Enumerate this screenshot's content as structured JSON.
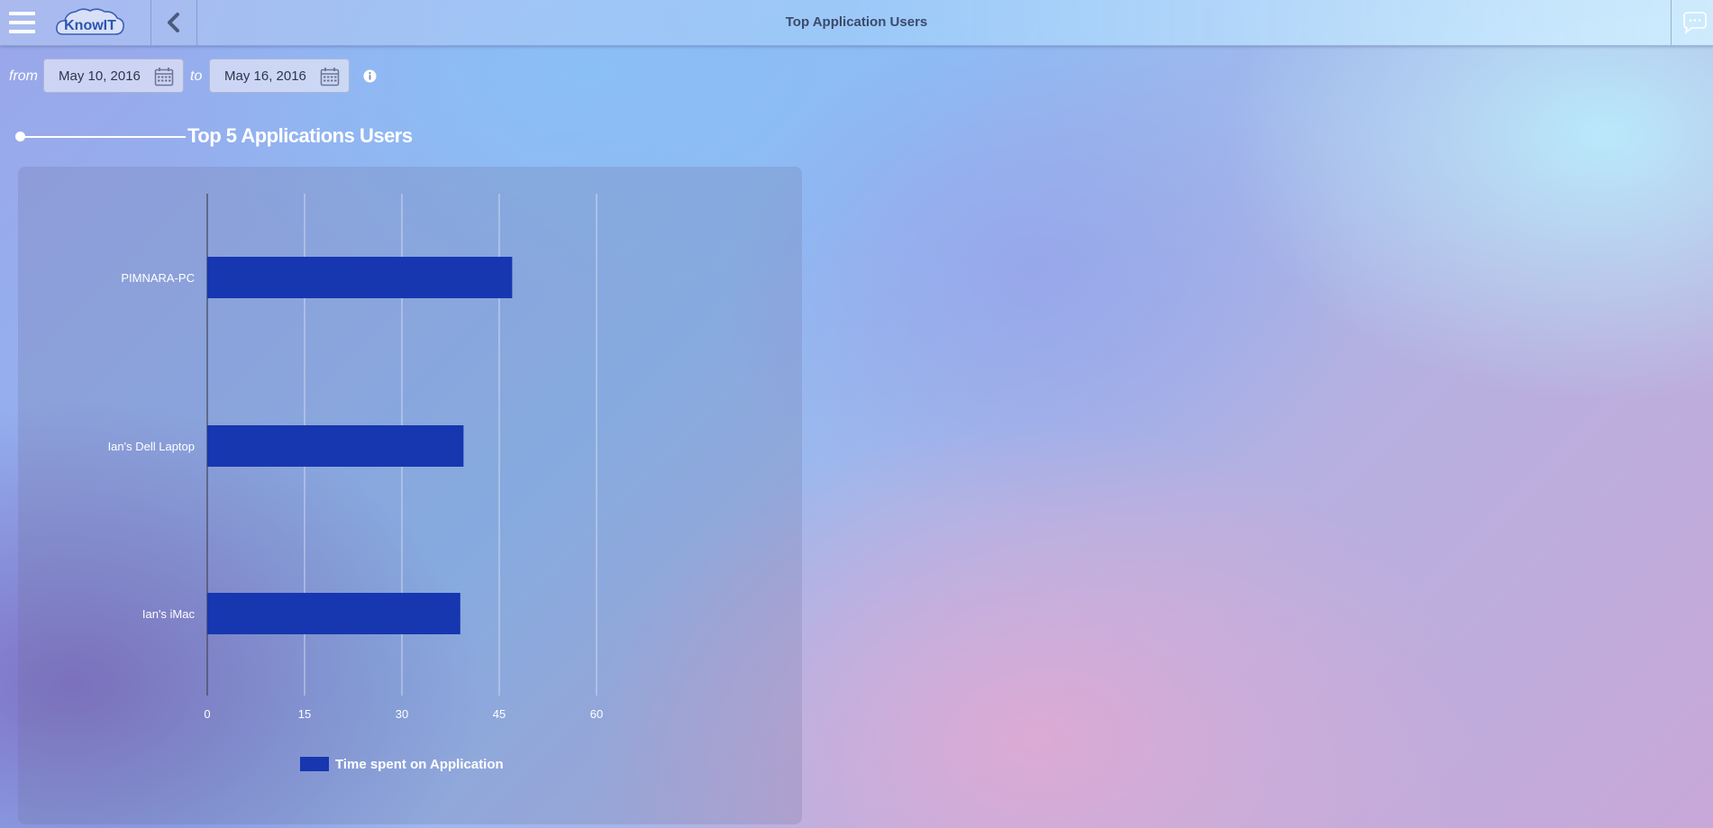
{
  "header": {
    "title": "Top Application Users",
    "logo_text": "KnowIT"
  },
  "date_range": {
    "from_label": "from",
    "from_value": "May 10, 2016",
    "to_label": "to",
    "to_value": "May 16, 2016"
  },
  "section": {
    "title": "Top 5 Applications Users"
  },
  "colors": {
    "bar": "#1637b0",
    "axis": "#4a4a60",
    "grid": "#e6e8f5"
  },
  "chart_data": {
    "type": "bar",
    "orientation": "horizontal",
    "categories": [
      "PIMNARA-PC",
      "Ian's Dell Laptop",
      "Ian's iMac"
    ],
    "series": [
      {
        "name": "Time spent on Application",
        "values": [
          47,
          39.5,
          39
        ]
      }
    ],
    "xticks": [
      0,
      15,
      30,
      45,
      60
    ],
    "xlim": [
      0,
      60
    ],
    "grid": true,
    "legend": "bottom-center"
  }
}
